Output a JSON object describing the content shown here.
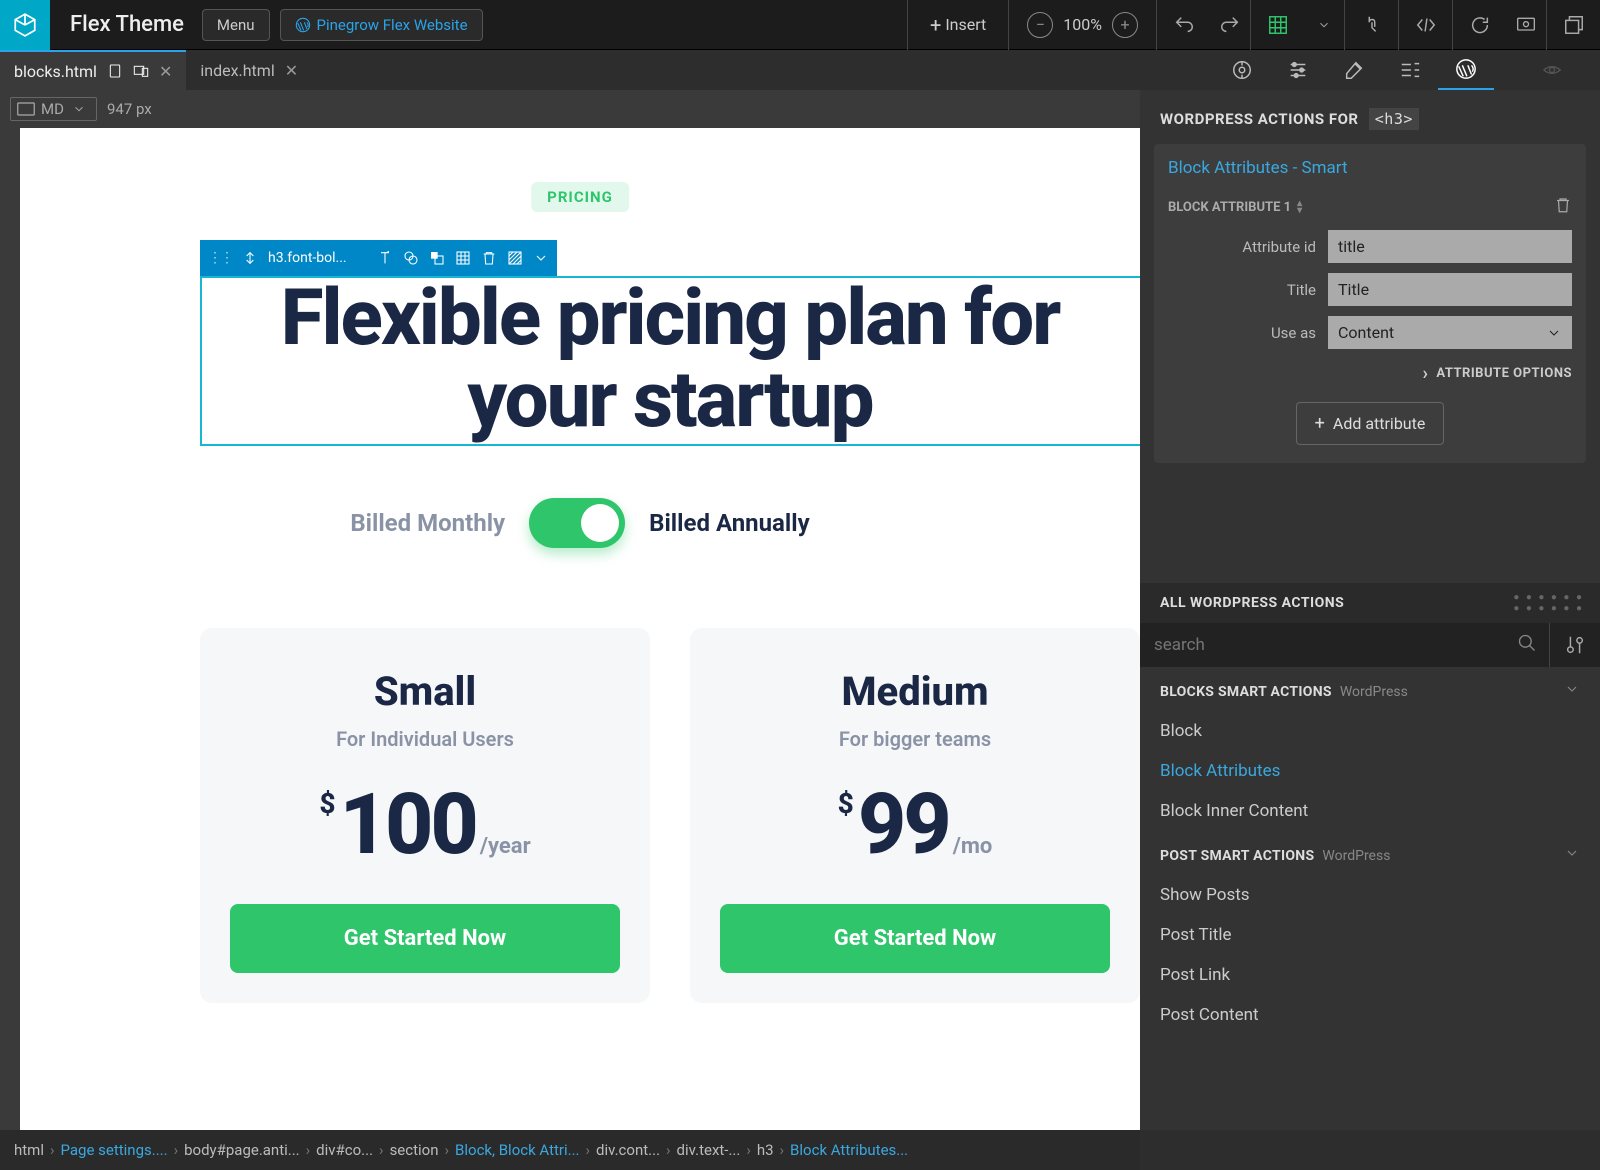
{
  "topbar": {
    "title": "Flex Theme",
    "menu": "Menu",
    "wp_link": "Pinegrow Flex Website",
    "insert": "Insert",
    "zoom": "100%"
  },
  "tabs": {
    "active": "blocks.html",
    "other": "index.html"
  },
  "canvas": {
    "breakpoint": "MD",
    "width": "947 px",
    "badge": "PRICING",
    "selected_element": "h3.font-bol...",
    "headline": "Flexible pricing plan for your startup",
    "billed_monthly": "Billed Monthly",
    "billed_annually": "Billed Annually",
    "cards": [
      {
        "name": "Small",
        "sub": "For Individual Users",
        "currency": "$",
        "amount": "100",
        "period": "/year",
        "cta": "Get Started Now"
      },
      {
        "name": "Medium",
        "sub": "For bigger teams",
        "currency": "$",
        "amount": "99",
        "period": "/mo",
        "cta": "Get Started Now"
      }
    ]
  },
  "panel": {
    "header_prefix": "WORDPRESS ACTIONS FOR",
    "header_tag": "<h3>",
    "card_title": "Block Attributes - Smart",
    "block_attr_label": "BLOCK ATTRIBUTE 1",
    "fields": {
      "attr_id_label": "Attribute id",
      "attr_id_value": "title",
      "title_label": "Title",
      "title_value": "Title",
      "use_as_label": "Use as",
      "use_as_value": "Content"
    },
    "attr_options": "ATTRIBUTE OPTIONS",
    "add_attr": "Add attribute",
    "all_actions": "ALL WORDPRESS ACTIONS",
    "search_placeholder": "search",
    "groups": [
      {
        "title": "BLOCKS SMART ACTIONS",
        "sub": "WordPress",
        "items": [
          {
            "label": "Block",
            "hl": false
          },
          {
            "label": "Block Attributes",
            "hl": true
          },
          {
            "label": "Block Inner Content",
            "hl": false
          }
        ]
      },
      {
        "title": "POST SMART ACTIONS",
        "sub": "WordPress",
        "items": [
          {
            "label": "Show Posts",
            "hl": false
          },
          {
            "label": "Post Title",
            "hl": false
          },
          {
            "label": "Post Link",
            "hl": false
          },
          {
            "label": "Post Content",
            "hl": false
          }
        ]
      }
    ]
  },
  "breadcrumb": [
    {
      "t": "html",
      "link": false
    },
    {
      "t": "Page settings....",
      "link": true
    },
    {
      "t": "body#page.anti...",
      "link": false
    },
    {
      "t": "div#co...",
      "link": false
    },
    {
      "t": "section",
      "link": false
    },
    {
      "t": "Block, Block Attri...",
      "link": true
    },
    {
      "t": "div.cont...",
      "link": false
    },
    {
      "t": "div.text-...",
      "link": false
    },
    {
      "t": "h3",
      "link": false
    },
    {
      "t": "Block Attributes...",
      "link": true
    }
  ]
}
